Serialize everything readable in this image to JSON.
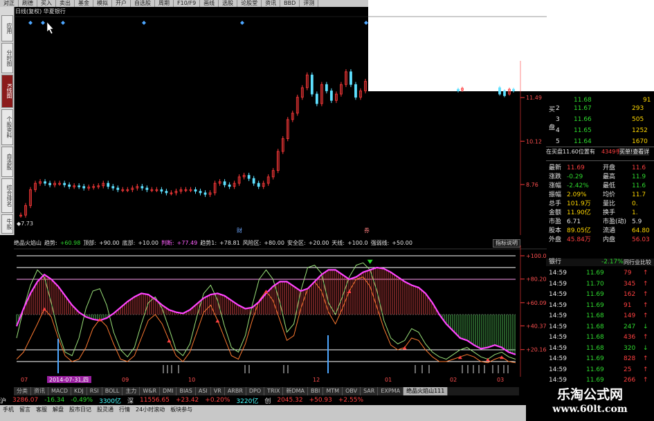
{
  "toolbar": {
    "items": [
      "对正",
      "刷德",
      "买入",
      "卖出",
      "基金",
      "模拟",
      "开户",
      "自选股",
      "周期",
      "F10/F9",
      "画线",
      "选股",
      "论股堂",
      "资讯",
      "BBD",
      "评测"
    ]
  },
  "sidetabs": {
    "items": [
      "应用",
      "分时图",
      "K线图",
      "个股资料",
      "自选股",
      "综合排名",
      "牛股"
    ]
  },
  "chart": {
    "title": "日线(复权) 华夏银行",
    "price_labels": [
      "11.49",
      "10.12",
      "8.76"
    ],
    "low_label": "7.73",
    "period_markers": [
      "财",
      "券"
    ],
    "candles": [
      7.8,
      8.1,
      8.6,
      8.8,
      8.85,
      8.8,
      8.75,
      8.8,
      8.8,
      8.75,
      8.7,
      8.72,
      8.7,
      8.65,
      8.68,
      8.7,
      8.72,
      8.8,
      8.7,
      8.65,
      8.6,
      8.6,
      8.6,
      8.65,
      8.7,
      8.65,
      8.6,
      8.6,
      8.6,
      8.55,
      8.5,
      8.5,
      8.55,
      8.6,
      8.6,
      8.6,
      8.55,
      8.5,
      8.45,
      8.5,
      8.8,
      8.85,
      8.75,
      8.7,
      8.8,
      9.0,
      9.05,
      8.95,
      8.8,
      8.7,
      8.8,
      9.0,
      9.2,
      9.8,
      10.2,
      10.8,
      11.0,
      11.5,
      11.8,
      12.2,
      11.6,
      11.3,
      11.9,
      11.7,
      11.4,
      11.6,
      11.9,
      12.3,
      11.9,
      11.5,
      11.7,
      12.0
    ]
  },
  "indicator": {
    "bar_items": [
      {
        "t": "绝品火焰山",
        "c": "white"
      },
      {
        "t": "趋势:",
        "c": "white"
      },
      {
        "t": "+60.98",
        "c": "green"
      },
      {
        "t": "顶部:",
        "c": "white"
      },
      {
        "t": "+90.00",
        "c": "white"
      },
      {
        "t": "底部:",
        "c": "white"
      },
      {
        "t": "+10.00",
        "c": "white"
      },
      {
        "t": "判断:",
        "c": "mag"
      },
      {
        "t": "+77.49",
        "c": "mag"
      },
      {
        "t": "趋势1:",
        "c": "white"
      },
      {
        "t": "+78.81",
        "c": "white"
      },
      {
        "t": "风险区:",
        "c": "white"
      },
      {
        "t": "+80.00",
        "c": "white"
      },
      {
        "t": "安全区:",
        "c": "white"
      },
      {
        "t": "+20.00",
        "c": "white"
      },
      {
        "t": "天线:",
        "c": "white"
      },
      {
        "t": "+100.0",
        "c": "white"
      },
      {
        "t": "强弱线:",
        "c": "white"
      },
      {
        "t": "+50.00",
        "c": "white"
      }
    ],
    "help_label": "指标说明",
    "scale_labels": [
      "+100.0",
      "+80.20",
      "+60.09",
      "+40.37",
      "+20.16"
    ],
    "date_label": "2014-07-31,四",
    "month_labels": [
      "07",
      "09",
      "10",
      "12",
      "01",
      "02",
      "03"
    ],
    "trend_line": [
      40,
      55,
      68,
      78,
      84,
      80,
      74,
      66,
      58,
      52,
      48,
      46,
      45,
      47,
      51,
      56,
      61,
      65,
      68,
      67,
      63,
      58,
      54,
      52,
      51,
      54,
      59,
      64,
      67,
      68,
      66,
      62,
      58,
      55,
      56,
      61,
      68,
      74,
      78,
      78,
      74,
      70,
      72,
      78,
      84,
      88,
      88,
      84,
      80,
      82,
      86,
      88,
      90,
      89,
      86,
      82,
      78,
      75,
      73,
      68,
      60,
      50,
      42,
      36,
      30,
      28,
      24,
      21,
      22,
      24,
      22,
      18,
      16
    ],
    "curve_line": [
      30,
      55,
      75,
      88,
      82,
      60,
      35,
      18,
      15,
      30,
      55,
      70,
      72,
      58,
      35,
      20,
      14,
      22,
      42,
      60,
      65,
      55,
      38,
      20,
      15,
      25,
      48,
      68,
      75,
      62,
      40,
      22,
      18,
      32,
      58,
      80,
      88,
      80,
      60,
      35,
      42,
      70,
      90,
      92,
      85,
      60,
      50,
      65,
      82,
      92,
      94,
      88,
      70,
      45,
      30,
      25,
      28,
      38,
      35,
      25,
      18,
      14,
      12,
      16,
      20,
      22,
      18,
      14,
      12,
      16,
      18,
      14,
      12
    ],
    "curve_line2": [
      12,
      18,
      30,
      42,
      55,
      48,
      30,
      15,
      10,
      12,
      22,
      38,
      46,
      40,
      25,
      12,
      10,
      15,
      30,
      45,
      50,
      42,
      28,
      15,
      10,
      18,
      35,
      52,
      58,
      45,
      30,
      15,
      12,
      25,
      45,
      62,
      70,
      62,
      45,
      28,
      32,
      55,
      72,
      78,
      70,
      52,
      42,
      55,
      70,
      80,
      82,
      74,
      56,
      38,
      24,
      20,
      22,
      30,
      28,
      20,
      14,
      10,
      10,
      12,
      14,
      16,
      14,
      10,
      9,
      12,
      14,
      10,
      9
    ],
    "signal_arrows_up": [
      4,
      12,
      22,
      29,
      36,
      48,
      56,
      64,
      68,
      70
    ],
    "signal_arrows_down": [
      51
    ]
  },
  "tabs": {
    "items": [
      "分类",
      "资讯",
      "MACD",
      "KDJ",
      "RSI",
      "BOLL",
      "主力",
      "W&R",
      "DMI",
      "BIAS",
      "ASI",
      "VR",
      "ARBR",
      "DPO",
      "TRIX",
      "新DMA",
      "BBI",
      "MTM",
      "OBV",
      "SAR",
      "EXPMA",
      "绝品火焰山111"
    ],
    "active_index": 21
  },
  "status": {
    "market1": "沪",
    "index1": "3286.07",
    "chg1": "-16.34",
    "pct1": "-0.49%",
    "vol1": "3300亿",
    "market2": "深",
    "index2": "11556.65",
    "chg2": "+23.42",
    "pct2": "+0.20%",
    "vol2": "3220亿",
    "market3": "创",
    "index3": "2045.32",
    "chg3": "+50.93",
    "pct3": "+2.55%"
  },
  "bottom": {
    "items": [
      "手机",
      "留言",
      "客服",
      "解盘",
      "股市日记",
      "股灵通",
      "行情",
      "24小时滚动",
      "板块参与"
    ]
  },
  "watermark": {
    "line1": "乐淘公式网",
    "line2": "www.60lt.com"
  },
  "right_panel": {
    "top_row": {
      "price": "11.68",
      "vol": "91"
    },
    "buy_label": "买",
    "pan_label": "盘",
    "buy_levels": [
      {
        "n": "2",
        "p": "11.67",
        "v": "293"
      },
      {
        "n": "3",
        "p": "11.66",
        "v": "505"
      },
      {
        "n": "4",
        "p": "11.65",
        "v": "1252"
      },
      {
        "n": "5",
        "p": "11.64",
        "v": "1670"
      }
    ],
    "queue_note": "在买盘11.60位置有",
    "queue_vol": "4349手",
    "queue_btn": "买单!查看详",
    "stats": [
      {
        "l": "最新",
        "v": "11.69",
        "l2": "开盘",
        "v2": "11.6",
        "c": "red"
      },
      {
        "l": "涨跌",
        "v": "-0.29",
        "l2": "最高",
        "v2": "11.9",
        "c": "green"
      },
      {
        "l": "涨幅",
        "v": "-2.42%",
        "l2": "最低",
        "v2": "11.6",
        "c": "green"
      },
      {
        "l": "振幅",
        "v": "2.09%",
        "l2": "均价",
        "v2": "11.7",
        "c": "yellow"
      },
      {
        "l": "总手",
        "v": "101.9万",
        "l2": "量比",
        "v2": "0.",
        "c": "yellow"
      },
      {
        "l": "金额",
        "v": "11.90亿",
        "l2": "换手",
        "v2": "1.",
        "c": "yellow"
      },
      {
        "l": "市盈",
        "v": "6.71",
        "l2": "市盈(动)",
        "v2": "5.9",
        "c": "white"
      },
      {
        "l": "股本",
        "v": "89.05亿",
        "l2": "流通",
        "v2": "64.80",
        "c": "yellow"
      },
      {
        "l": "外盘",
        "v": "45.84万",
        "l2": "内盘",
        "v2": "56.03",
        "c": "red"
      }
    ],
    "sector": {
      "name": "银行",
      "pct": "-2.17%",
      "btn": "同行业比较"
    },
    "ticks": [
      {
        "t": "14:59",
        "p": "11.69",
        "v": "79",
        "d": "up"
      },
      {
        "t": "14:59",
        "p": "11.70",
        "v": "345",
        "d": "up"
      },
      {
        "t": "14:59",
        "p": "11.69",
        "v": "162",
        "d": "up"
      },
      {
        "t": "14:59",
        "p": "11.69",
        "v": "91",
        "d": "up"
      },
      {
        "t": "14:59",
        "p": "11.68",
        "v": "149",
        "d": "up"
      },
      {
        "t": "14:59",
        "p": "11.68",
        "v": "247",
        "d": "down"
      },
      {
        "t": "14:59",
        "p": "11.68",
        "v": "436",
        "d": "up"
      },
      {
        "t": "14:59",
        "p": "11.68",
        "v": "320",
        "d": "down"
      },
      {
        "t": "14:59",
        "p": "11.69",
        "v": "828",
        "d": "up"
      },
      {
        "t": "14:59",
        "p": "11.69",
        "v": "25",
        "d": "up"
      },
      {
        "t": "14:59",
        "p": "11.69",
        "v": "266",
        "d": "up"
      }
    ]
  }
}
